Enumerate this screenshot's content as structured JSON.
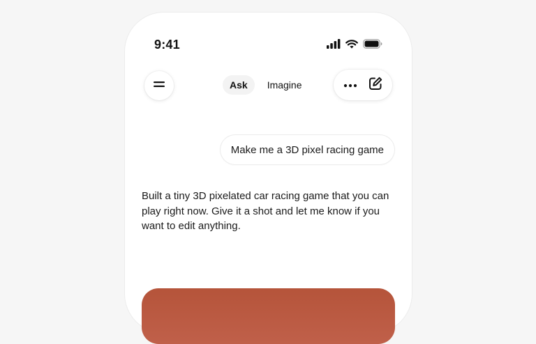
{
  "status_bar": {
    "time": "9:41"
  },
  "header": {
    "tabs": [
      {
        "label": "Ask",
        "active": true
      },
      {
        "label": "Imagine",
        "active": false
      }
    ]
  },
  "conversation": {
    "user_message": "Make me a 3D pixel racing game",
    "assistant_message": "Built a tiny 3D pixelated car racing game that you can play right now. Give it a shot and let me know if you want to edit anything."
  },
  "colors": {
    "page_background": "#f6f6f6",
    "phone_background": "#ffffff",
    "game_card": "#b5543a"
  },
  "icons": [
    "signal-icon",
    "wifi-icon",
    "battery-icon",
    "menu-icon",
    "more-icon",
    "new-chat-icon"
  ]
}
